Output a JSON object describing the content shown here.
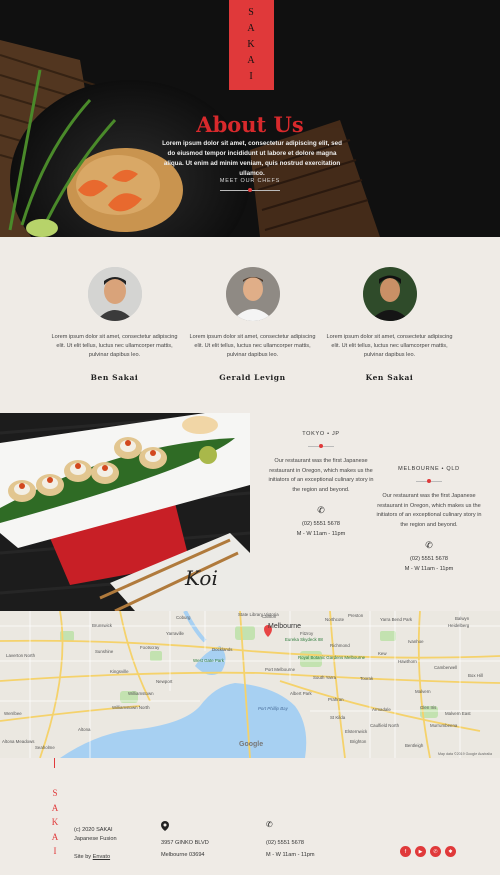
{
  "hero": {
    "logo_letters": [
      "S",
      "A",
      "K",
      "A",
      "I"
    ],
    "title": "About Us",
    "text": "Lorem ipsum dolor sit amet, consectetur adipiscing elit, sed do eiusmod tempor incididunt ut labore et dolore magna aliqua. Ut enim ad minim veniam, quis nostrud exercitation ullamco.",
    "cta_label": "MEET OUR CHEFS"
  },
  "chefs": [
    {
      "name": "Ben Sakai",
      "bio": "Lorem ipsum dolor sit amet, consectetur adipiscing elit. Ut elit tellus, luctus nec ullamcorper mattis, pulvinar dapibus leo."
    },
    {
      "name": "Gerald Levign",
      "bio": "Lorem ipsum dolor sit amet, consectetur adipiscing elit. Ut elit tellus, luctus nec ullamcorper mattis, pulvinar dapibus leo."
    },
    {
      "name": "Ken Sakai",
      "bio": "Lorem ipsum dolor sit amet, consectetur adipiscing elit. Ut elit tellus, luctus nec ullamcorper mattis, pulvinar dapibus leo."
    }
  ],
  "locations": [
    {
      "city": "TOKYO • JP",
      "desc": "Our restaurant was the first Japanese restaurant in Oregon, which makes us the initiators of an exceptional culinary story in the region and beyond.",
      "phone": "(02) 5551 5678",
      "hours": "M - W 11am - 11pm"
    },
    {
      "city": "MELBOURNE • QLD",
      "desc": "Our restaurant was the first Japanese restaurant in Oregon, which makes us the initiators of an exceptional culinary story in the region and beyond.",
      "phone": "(02) 5551 5678",
      "hours": "M - W 11am - 11pm"
    }
  ],
  "sushi_sign": "Koi",
  "map": {
    "labels": [
      "Brunswick",
      "Coburg",
      "Ivanhoe",
      "Heidelberg",
      "Kew",
      "Melbourne",
      "Yarraville",
      "Footscray",
      "Sunshine",
      "Richmond",
      "Hawthorn",
      "Camberwell",
      "Port Melbourne",
      "Newport",
      "Williamstown",
      "South Yarra",
      "Toorak",
      "Malvern",
      "St Kilda",
      "Brighton",
      "Altona",
      "Elsternwick",
      "Caulfield North",
      "Glen Iris",
      "Balwyn",
      "Box Hill",
      "Laverton North",
      "Altona Meadows",
      "Werribee",
      "Yarra Bend Park",
      "Carlton",
      "Fitzroy",
      "Eureka Skydeck 88",
      "Royal Botanic Gardens Melbourne",
      "West Gate Park",
      "Williamstown North",
      "Prahran",
      "Armadale",
      "Bentleigh",
      "Murrumbeena",
      "Malvern East",
      "Port Phillip Bay",
      "Seaholme",
      "Kingsville",
      "Northcote",
      "Preston",
      "Albert Park",
      "Docklands",
      "State Library Victoria"
    ],
    "google": "Google",
    "credit": "Map data ©2019 Google   Australia"
  },
  "footer": {
    "logo_letters": [
      "S",
      "A",
      "K",
      "A",
      "I"
    ],
    "copyright": "(c) 2020 SAKAI",
    "tagline": "Japanese Fusion",
    "site_by_prefix": "Site by ",
    "site_by_link": "Envato",
    "address_line1": "3957 GINKO BLVD",
    "address_line2": "Melbourne 03694",
    "phone": "(02) 5551 5678",
    "hours": "M - W 11am - 11pm",
    "social": [
      "facebook-icon",
      "youtube-icon",
      "whatsapp-icon",
      "yelp-icon"
    ]
  },
  "colors": {
    "accent": "#e0393a",
    "background": "#efebe6",
    "dark": "#111111"
  }
}
